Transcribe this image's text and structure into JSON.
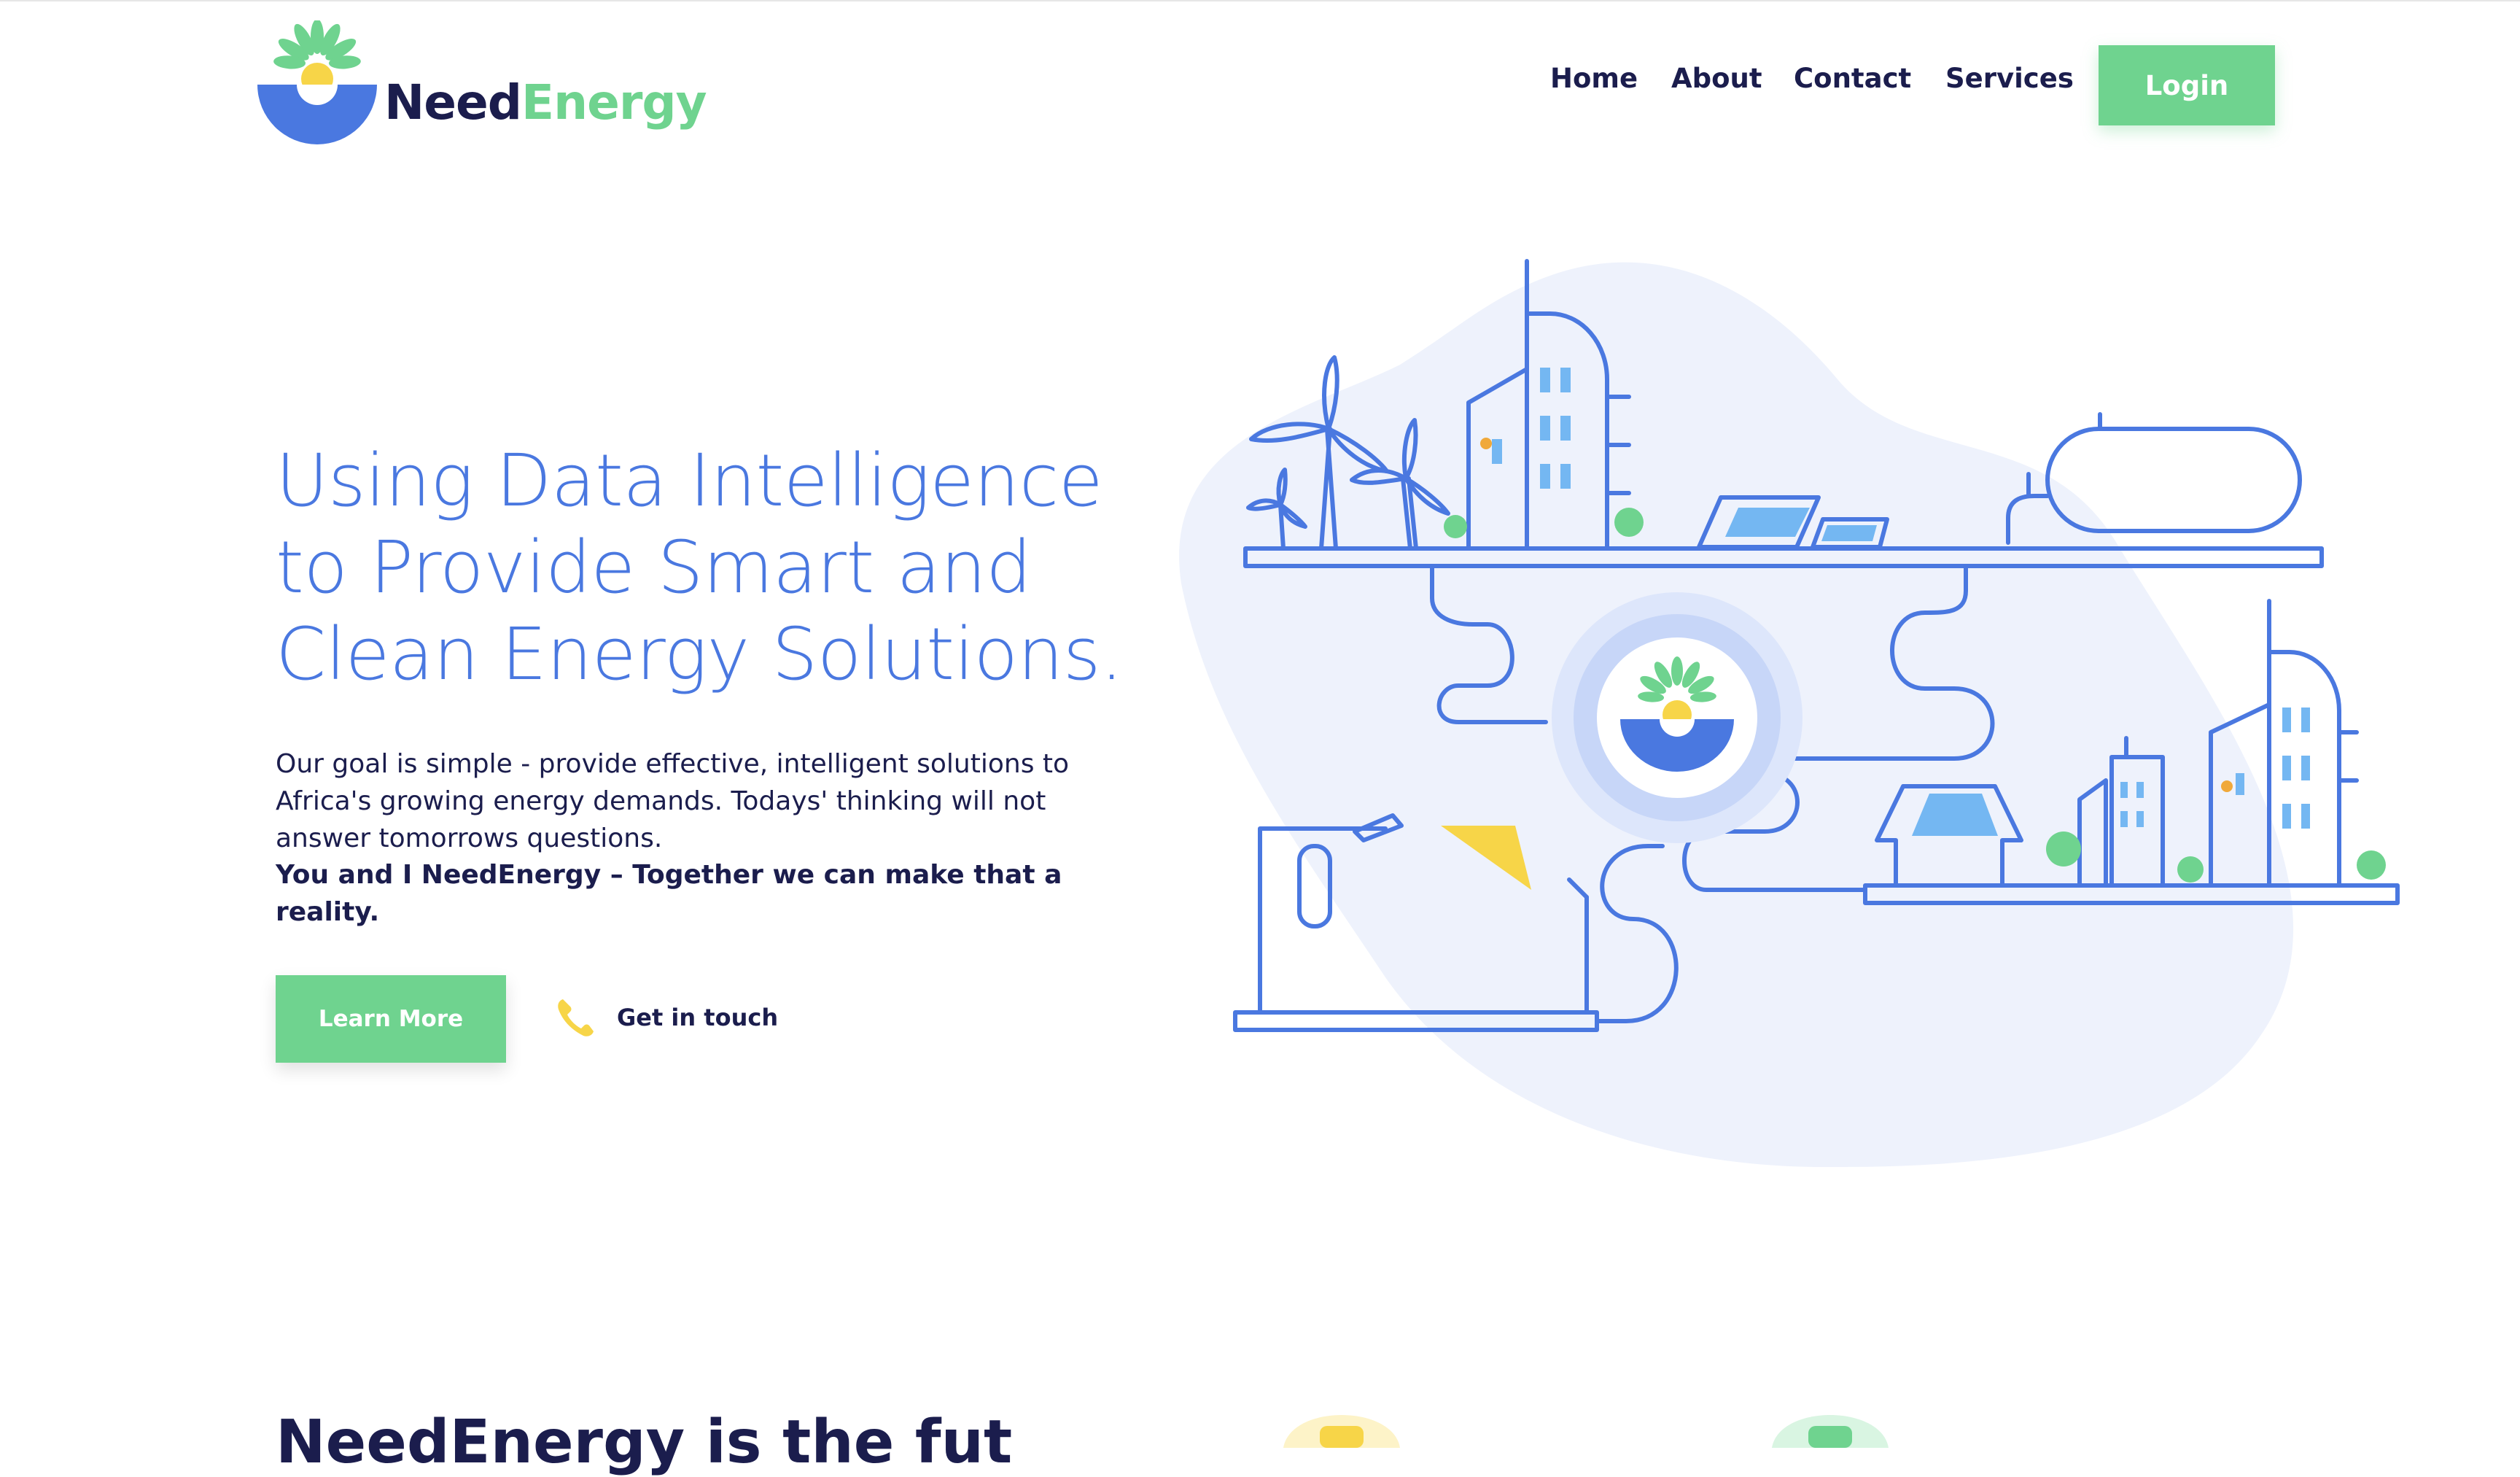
{
  "brand": {
    "name_part1": "Need",
    "name_part2": "Energy",
    "primary_color": "#4a78e0",
    "accent_color": "#6fd38f",
    "sun_color": "#f7d548",
    "dark_text": "#1b1d4d"
  },
  "nav": {
    "items": [
      {
        "label": "Home"
      },
      {
        "label": "About"
      },
      {
        "label": "Contact"
      },
      {
        "label": "Services"
      }
    ],
    "login_label": "Login"
  },
  "hero": {
    "title_lines": [
      "Using Data Intelligence",
      "to Provide Smart and",
      "Clean Energy Solutions."
    ],
    "description": "Our goal is simple - provide effective, intelligent solutions to Africa's growing energy demands. Todays' thinking will not answer tomorrows questions.",
    "tagline": "You and I NeedEnergy – Together we can make that a reality.",
    "learn_more_label": "Learn More",
    "get_in_touch_label": "Get in touch"
  },
  "next_section": {
    "heading_partial": "NeedEnergy is the fut"
  },
  "icons": {
    "phone": "phone-icon",
    "logo": "sun-logo-icon"
  }
}
